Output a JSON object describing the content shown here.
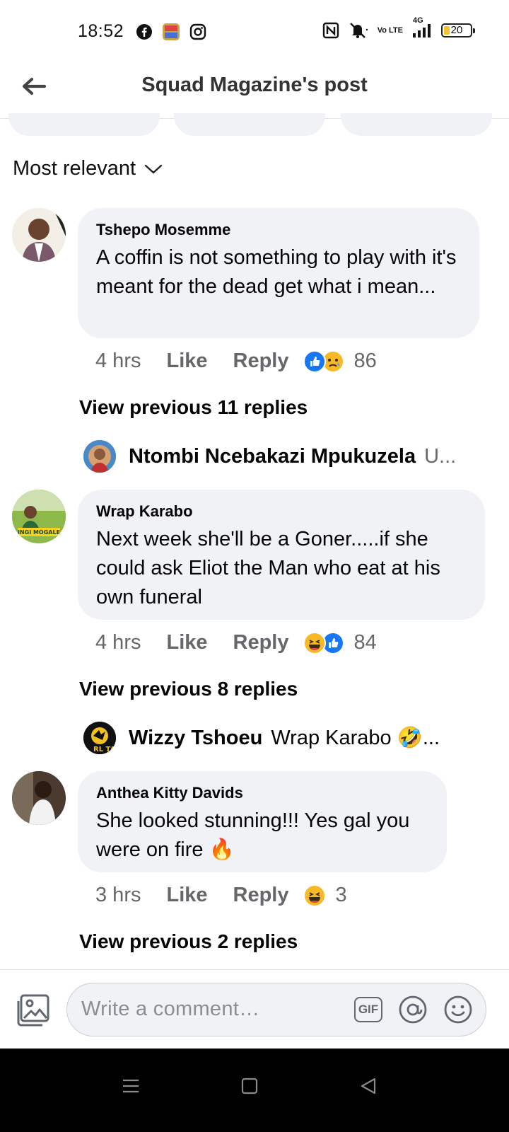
{
  "status_bar": {
    "time": "18:52",
    "battery": "20",
    "network": "4G",
    "volte": "Vo LTE"
  },
  "header": {
    "title": "Squad Magazine's post"
  },
  "sort": {
    "label": "Most relevant"
  },
  "comments": [
    {
      "author": "Tshepo Mosemme",
      "text": "A coffin is not something to play with it's meant for the dead get what i mean...",
      "time": "4 hrs",
      "like": "Like",
      "reply": "Reply",
      "reactions": [
        "like",
        "sad"
      ],
      "count": "86",
      "view_previous": "View previous 11 replies",
      "reply_preview": {
        "author": "Ntombi Ncebakazi Mpukuzela",
        "text": "U..."
      }
    },
    {
      "author": "Wrap Karabo",
      "text": "Next week she'll be a Goner.....if she could ask Eliot the Man who eat at his own funeral",
      "time": "4 hrs",
      "like": "Like",
      "reply": "Reply",
      "reactions": [
        "haha",
        "like"
      ],
      "count": "84",
      "view_previous": "View previous 8 replies",
      "reply_preview": {
        "author": "Wizzy Tshoeu",
        "text": "Wrap Karabo 🤣..."
      }
    },
    {
      "author": "Anthea Kitty Davids",
      "text": "She looked stunning!!! Yes gal you were on fire 🔥",
      "time": "3 hrs",
      "like": "Like",
      "reply": "Reply",
      "reactions": [
        "haha"
      ],
      "count": "3",
      "view_previous": "View previous 2 replies"
    }
  ],
  "composer": {
    "placeholder": "Write a comment…",
    "gif_label": "GIF"
  },
  "colors": {
    "bubble": "#f0f2f5",
    "meta_text": "#65676b",
    "like_blue": "#1877f2",
    "haha_yellow": "#f7b928"
  }
}
